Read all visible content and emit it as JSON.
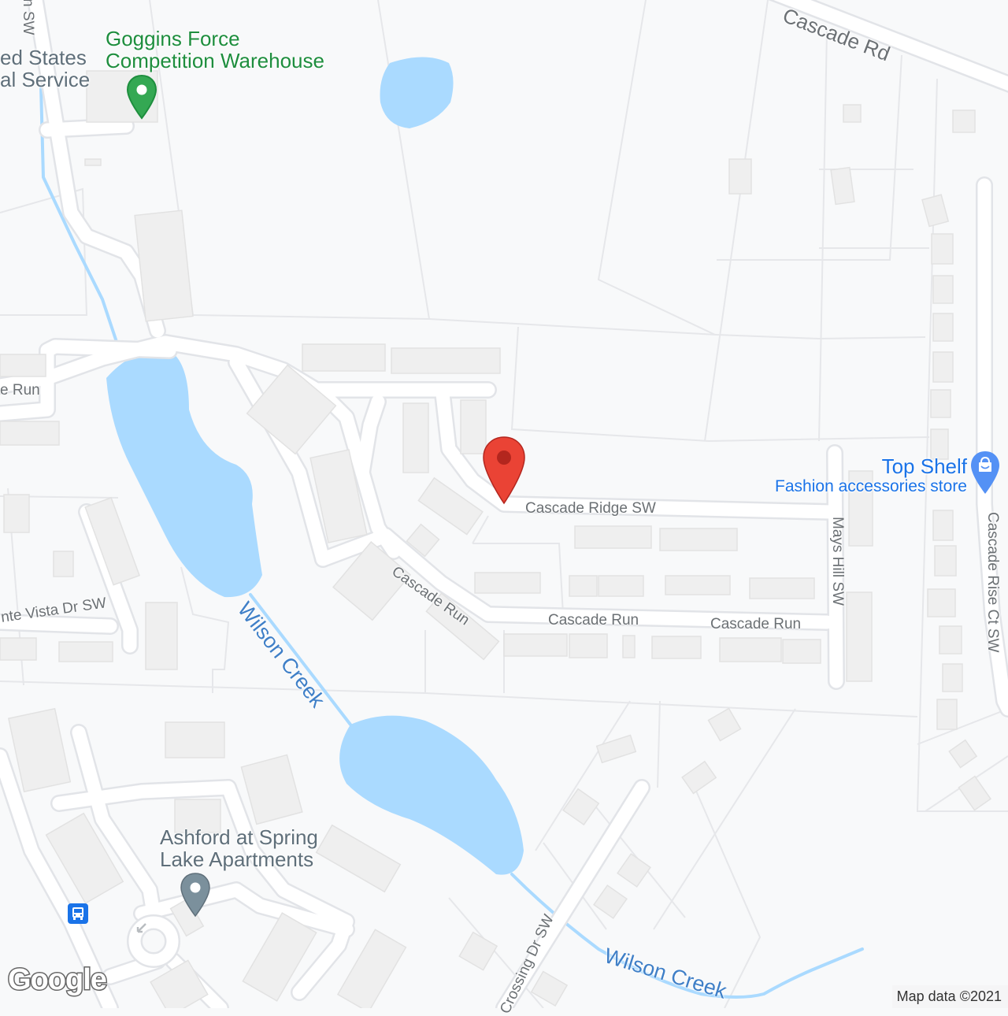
{
  "map": {
    "colors": {
      "background": "#f8f9fa",
      "road": "#ffffff",
      "road_edge": "#e2e4e8",
      "parcel_line": "#e6e7ea",
      "building": "#efefef",
      "water": "#aadaff",
      "water_label": "#3f7fc7",
      "road_label": "#6b7074",
      "selected_pin": "#ea4335",
      "poi_green": "#1e8e3e",
      "poi_blue": "#1a73e8",
      "poi_gray": "#5f6f7a"
    },
    "roads": [
      {
        "name": "Cascade Rd",
        "label": "Cascade Rd"
      },
      {
        "name": "Cascade Ridge SW",
        "label": "Cascade Ridge SW"
      },
      {
        "name": "Cascade Run",
        "label": "Cascade Run"
      },
      {
        "name": "Cascade Run (2)",
        "label": "Cascade Run"
      },
      {
        "name": "Cascade Run (3)",
        "label": "Cascade Run"
      },
      {
        "name": "Cascade Run (4)",
        "label": "Cascade Run"
      },
      {
        "name": "Cascade Run (west)",
        "label": "e Run"
      },
      {
        "name": "Mays Hill SW",
        "label": "Mays Hill SW"
      },
      {
        "name": "Cascade Rise Ct SW",
        "label": "Cascade Rise Ct SW"
      },
      {
        "name": "Monte Vista Dr SW",
        "label": "nte Vista Dr SW"
      },
      {
        "name": "Crossing Dr SW",
        "label": "Crossing Dr SW"
      },
      {
        "name": "...n SW",
        "label": "n SW"
      }
    ],
    "waterways": [
      {
        "label": "Wilson Creek"
      },
      {
        "label": "Wilson Creek"
      }
    ],
    "places": [
      {
        "name": "Goggins Force Competition Warehouse",
        "lines": [
          "Goggins Force",
          "Competition Warehouse"
        ],
        "icon": "pin-icon",
        "color": "#1e8e3e"
      },
      {
        "name": "United States Postal Service",
        "lines": [
          "ed States",
          "al Service"
        ],
        "color": "#5f6f7a"
      },
      {
        "name": "Top Shelf",
        "lines": [
          "Top Shelf"
        ],
        "category": "Fashion accessories store",
        "icon": "shopping-bag-icon",
        "color": "#1a73e8"
      },
      {
        "name": "Ashford at Spring Lake Apartments",
        "lines": [
          "Ashford at Spring",
          "Lake Apartments"
        ],
        "icon": "pin-icon",
        "color": "#5f6f7a"
      }
    ],
    "selected_marker": {
      "icon": "red-pin-icon",
      "near": "Cascade Ridge SW"
    },
    "transit": {
      "icon": "bus-stop-icon"
    },
    "footer": {
      "logo": "Google",
      "attribution": "Map data ©2021"
    }
  }
}
